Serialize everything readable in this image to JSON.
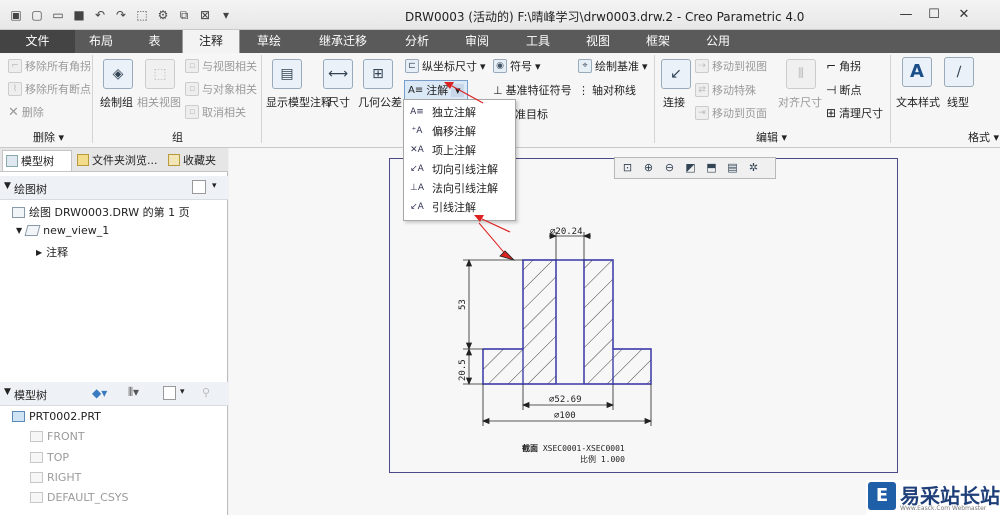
{
  "window": {
    "title": "DRW0003 (活动的) F:\\晴峰学习\\drw0003.drw.2 - Creo Parametric 4.0",
    "minimize": "—",
    "maximize": "☐",
    "close": "✕"
  },
  "tabs": [
    {
      "label": "文件"
    },
    {
      "label": "布局"
    },
    {
      "label": "表"
    },
    {
      "label": "注释"
    },
    {
      "label": "草绘"
    },
    {
      "label": "继承迁移"
    },
    {
      "label": "分析"
    },
    {
      "label": "审阅"
    },
    {
      "label": "工具"
    },
    {
      "label": "视图"
    },
    {
      "label": "框架"
    },
    {
      "label": "公用"
    }
  ],
  "ribbon": {
    "delete_group": {
      "remove_all_corners": "移除所有角拐",
      "remove_all_breaks": "移除所有断点",
      "delete": "删除",
      "label": "删除"
    },
    "group_group": {
      "draw_group": "绘制组",
      "related_view": "相关视图",
      "relate_to_view": "与视图相关",
      "relate_to_object": "与对象相关",
      "cancel_relate": "取消相关",
      "label": "组"
    },
    "annotation": {
      "show_model_annotation": "显示模型注释",
      "dimension": "尺寸",
      "gtol": "几何公差",
      "ordinate_dim": "纵坐标尺寸",
      "note": "注解",
      "symbol": "符号",
      "draw_datum": "绘制基准",
      "datum_feature_symbol": "基准特征符号",
      "axis_symmetry": "轴对称线",
      "datum_target": "基准目标"
    },
    "edit_group": {
      "connect": "连接",
      "move_to_view": "移动到视图",
      "move_special": "移动特殊",
      "move_to_page": "移动到页面",
      "align_dimensions": "对齐尺寸",
      "corner": "角拐",
      "break_point": "断点",
      "clean_dims": "清理尺寸",
      "label": "编辑"
    },
    "format_group": {
      "text_style": "文本样式",
      "line_style": "线型",
      "label": "格式"
    }
  },
  "left_panel": {
    "tabs": {
      "model_tree": "模型树",
      "folder_browser": "文件夹浏览...",
      "favorites": "收藏夹"
    },
    "drawing_tree": {
      "header": "绘图树",
      "items": [
        "绘图 DRW0003.DRW 的第 1 页",
        "new_view_1",
        "注释"
      ]
    },
    "model_tree": {
      "header": "模型树",
      "items": [
        "PRT0002.PRT",
        "FRONT",
        "TOP",
        "RIGHT",
        "DEFAULT_CSYS"
      ]
    }
  },
  "dropdown": {
    "items": [
      "独立注解",
      "偏移注解",
      "项上注解",
      "切向引线注解",
      "法向引线注解",
      "引线注解"
    ]
  },
  "drawing": {
    "dim_top": "⌀20.24",
    "dim_height": "53",
    "dim_flange": "20.5",
    "dim_mid": "⌀52.69",
    "dim_outer": "⌀100",
    "section_label": "XSEC0001-XSEC0001",
    "scale_label": "比例",
    "scale_value": "1.000"
  },
  "watermark": {
    "logo": "E",
    "text": "易采站长站",
    "sub": "Www.Easck.Com Webmaster"
  }
}
